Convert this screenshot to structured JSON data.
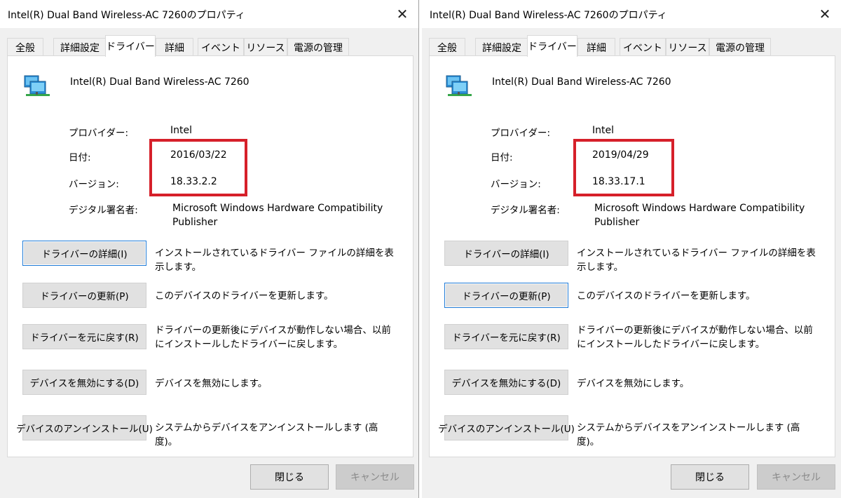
{
  "dialogs": [
    {
      "title": "Intel(R) Dual Band Wireless-AC 7260のプロパティ",
      "close_glyph": "✕",
      "tabs": [
        "全般",
        "詳細設定",
        "ドライバー",
        "詳細",
        "イベント",
        "リソース",
        "電源の管理"
      ],
      "active_tab": "ドライバー",
      "device_name": "Intel(R) Dual Band Wireless-AC 7260",
      "device_icon": "network-adapter-icon",
      "info": {
        "provider_label": "プロバイダー:",
        "provider_value": "Intel",
        "date_label": "日付:",
        "date_value": "2016/03/22",
        "version_label": "バージョン:",
        "version_value": "18.33.2.2",
        "signer_label": "デジタル署名者:",
        "signer_value": "Microsoft Windows Hardware Compatibility Publisher"
      },
      "actions": [
        {
          "label": "ドライバーの詳細(I)",
          "desc": "インストールされているドライバー ファイルの詳細を表示します。"
        },
        {
          "label": "ドライバーの更新(P)",
          "desc": "このデバイスのドライバーを更新します。"
        },
        {
          "label": "ドライバーを元に戻す(R)",
          "desc": "ドライバーの更新後にデバイスが動作しない場合、以前にインストールしたドライバーに戻します。"
        },
        {
          "label": "デバイスを無効にする(D)",
          "desc": "デバイスを無効にします。"
        },
        {
          "label": "デバイスのアンインストール(U)",
          "desc": "システムからデバイスをアンインストールします (高度)。"
        }
      ],
      "focused_action": "ドライバーの詳細(I)",
      "ok_label": "閉じる",
      "cancel_label": "キャンセル"
    },
    {
      "title": "Intel(R) Dual Band Wireless-AC 7260のプロパティ",
      "close_glyph": "✕",
      "tabs": [
        "全般",
        "詳細設定",
        "ドライバー",
        "詳細",
        "イベント",
        "リソース",
        "電源の管理"
      ],
      "active_tab": "ドライバー",
      "device_name": "Intel(R) Dual Band Wireless-AC 7260",
      "device_icon": "network-adapter-icon",
      "info": {
        "provider_label": "プロバイダー:",
        "provider_value": "Intel",
        "date_label": "日付:",
        "date_value": "2019/04/29",
        "version_label": "バージョン:",
        "version_value": "18.33.17.1",
        "signer_label": "デジタル署名者:",
        "signer_value": "Microsoft Windows Hardware Compatibility Publisher"
      },
      "actions": [
        {
          "label": "ドライバーの詳細(I)",
          "desc": "インストールされているドライバー ファイルの詳細を表示します。"
        },
        {
          "label": "ドライバーの更新(P)",
          "desc": "このデバイスのドライバーを更新します。"
        },
        {
          "label": "ドライバーを元に戻す(R)",
          "desc": "ドライバーの更新後にデバイスが動作しない場合、以前にインストールしたドライバーに戻します。"
        },
        {
          "label": "デバイスを無効にする(D)",
          "desc": "デバイスを無効にします。"
        },
        {
          "label": "デバイスのアンインストール(U)",
          "desc": "システムからデバイスをアンインストールします (高度)。"
        }
      ],
      "focused_action": "ドライバーの更新(P)",
      "ok_label": "閉じる",
      "cancel_label": "キャンセル"
    }
  ],
  "colors": {
    "highlight_box": "#d6202a",
    "focus_border": "#1f7ad6"
  }
}
